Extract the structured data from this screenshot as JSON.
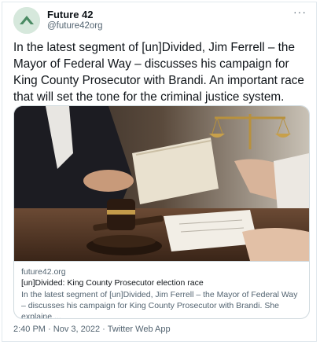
{
  "author": {
    "name": "Future 42",
    "handle": "@future42org"
  },
  "more_icon": "···",
  "tweet": {
    "text": "In the latest segment of [un]Divided, Jim Ferrell – the Mayor of Federal Way – discusses his campaign for King County Prosecutor with Brandi. An important race that will set the tone for the criminal justice system."
  },
  "link_card": {
    "image_description": "gavel and scales of justice with a judge at desk",
    "domain": "future42.org",
    "title": "[un]Divided: King County Prosecutor election race",
    "description": "In the latest segment of [un]Divided, Jim Ferrell – the Mayor of Federal Way – discusses his campaign for King County Prosecutor with Brandi. She explaine ..."
  },
  "meta": {
    "time": "2:40 PM",
    "separator": "·",
    "date": "Nov 3, 2022",
    "source": "Twitter Web App"
  },
  "colors": {
    "text_primary": "#0f1419",
    "text_secondary": "#536471",
    "border": "#cfd9de",
    "avatar_bg": "#cfe3d6",
    "avatar_mark": "#3f7f5a"
  }
}
